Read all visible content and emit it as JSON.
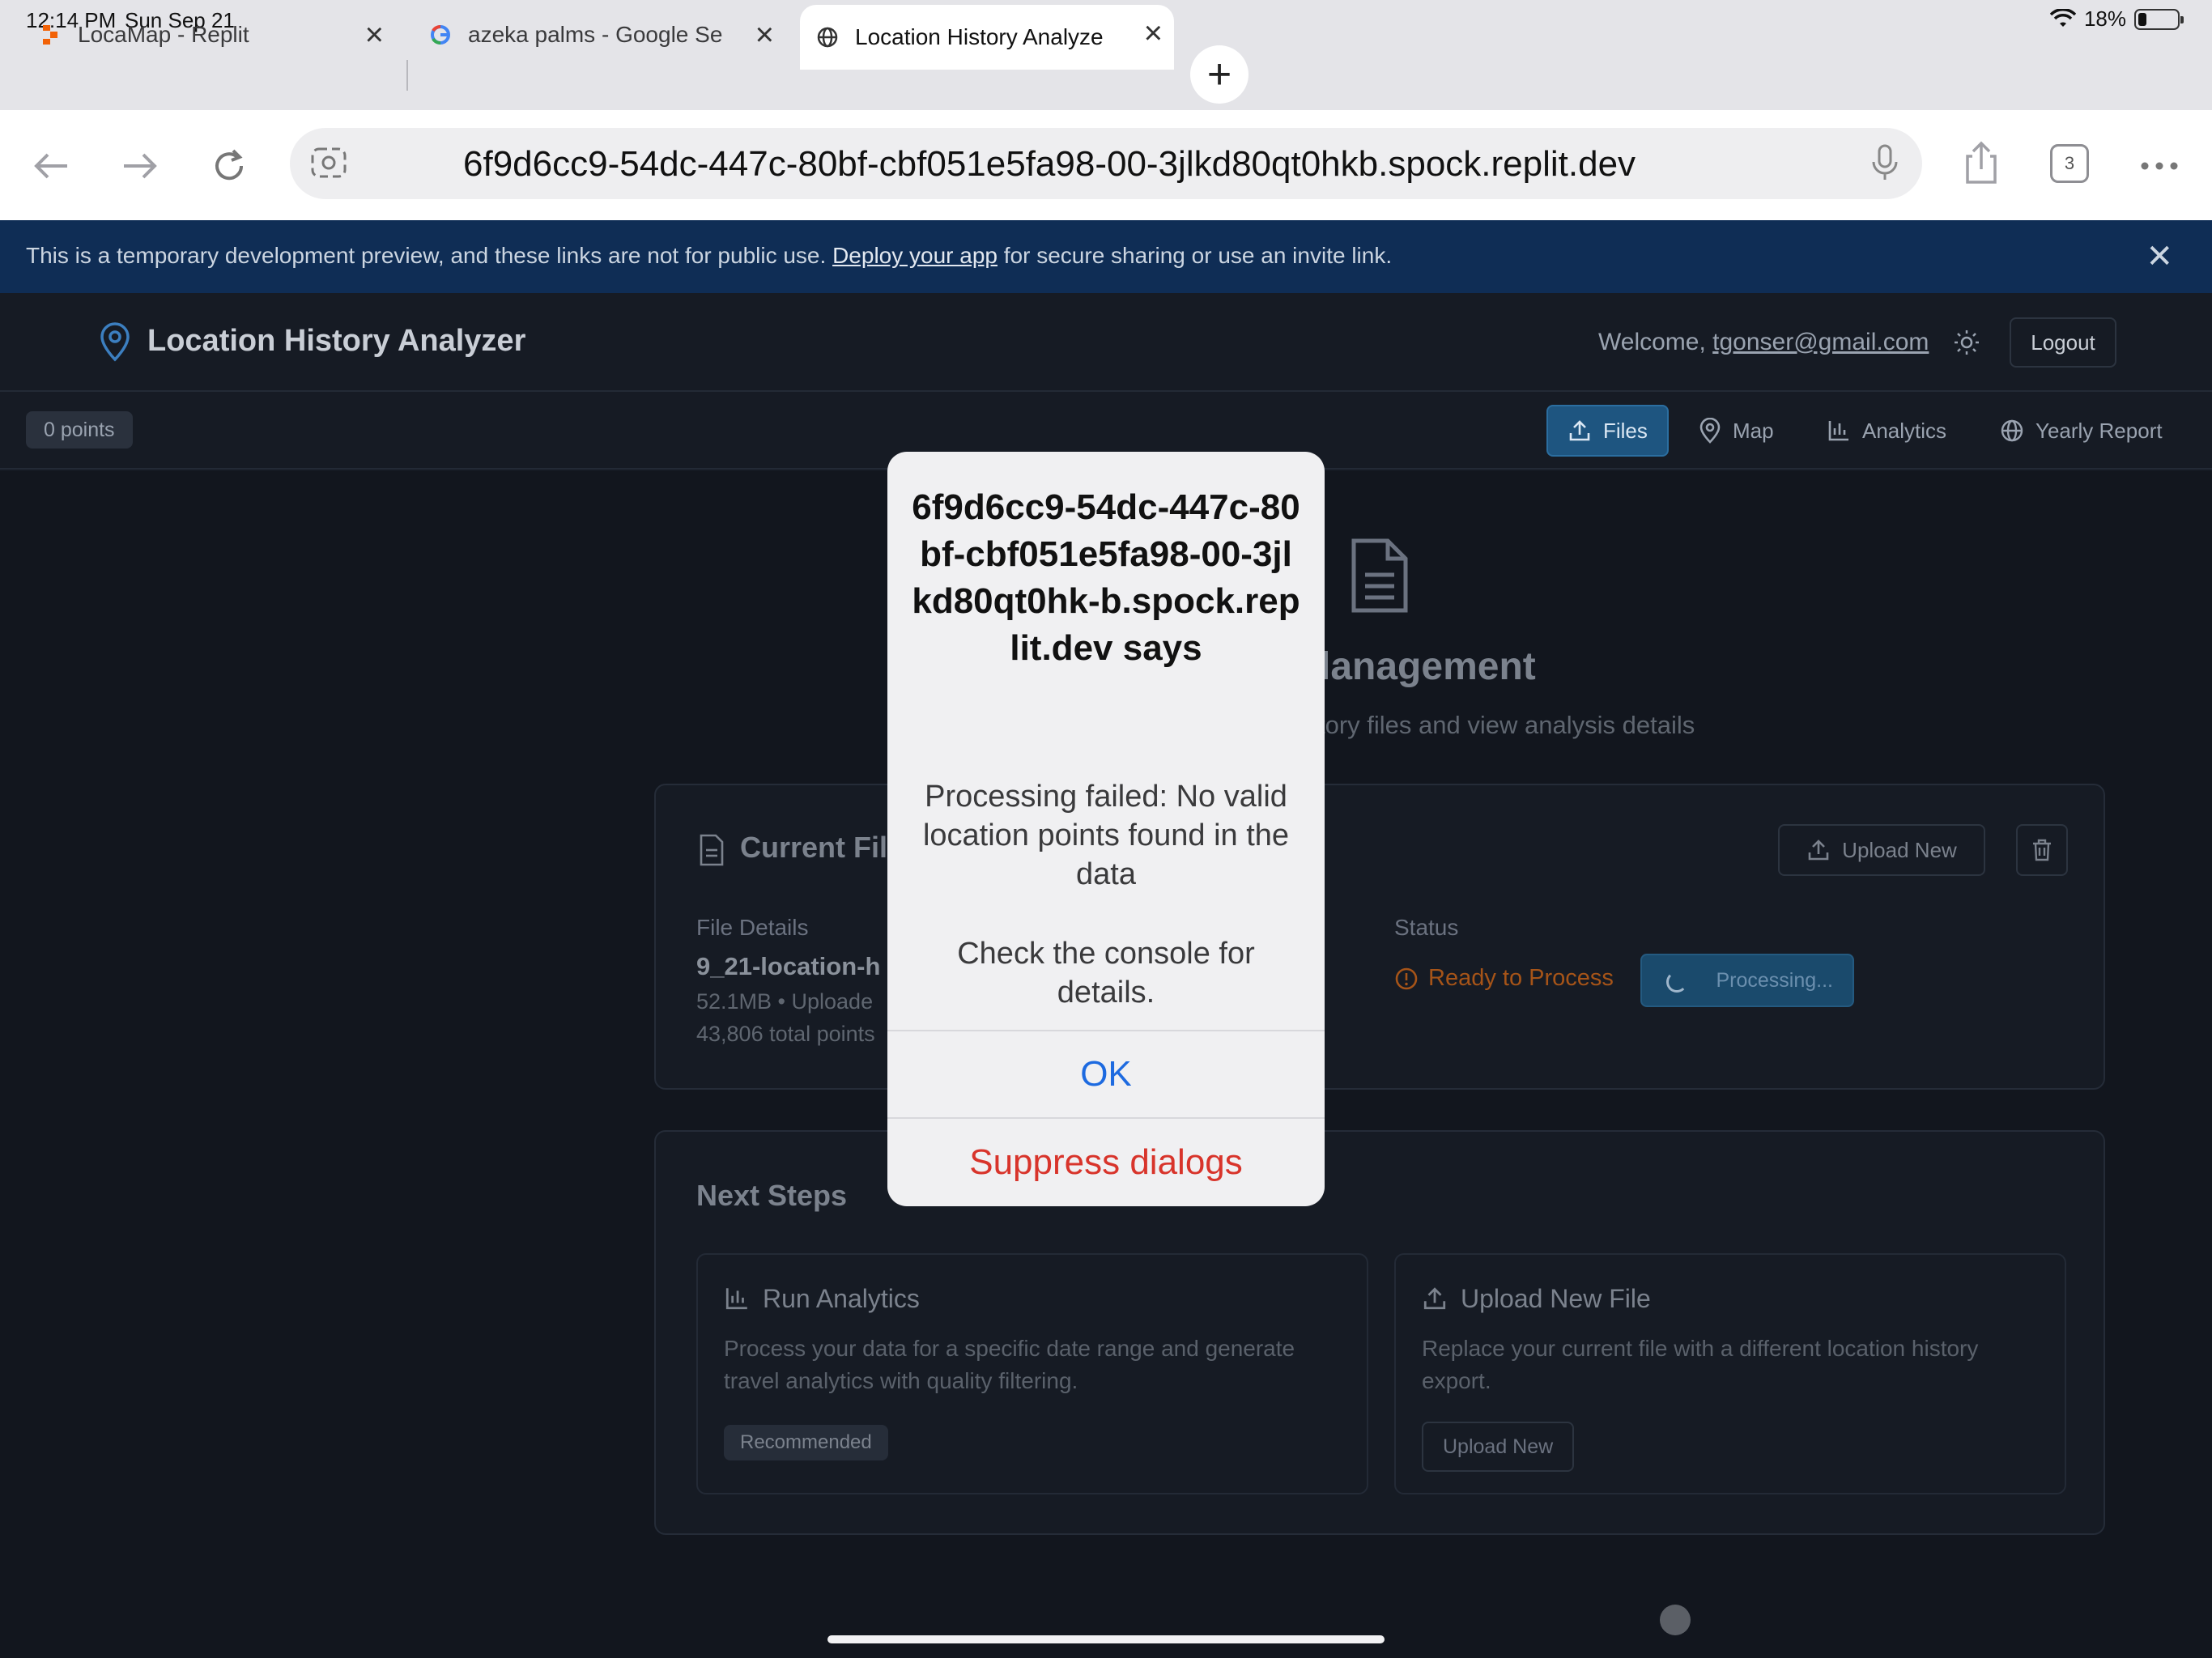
{
  "status_bar": {
    "time": "12:14 PM",
    "date": "Sun Sep 21",
    "battery": "18%"
  },
  "tabs": [
    {
      "label": "LocaMap - Replit",
      "icon": "replit-icon"
    },
    {
      "label": "azeka palms - Google Se",
      "icon": "google-icon"
    },
    {
      "label": "Location History Analyze",
      "icon": "globe-icon",
      "active": true
    }
  ],
  "address_bar": {
    "url": "6f9d6cc9-54dc-447c-80bf-cbf051e5fa98-00-3jlkd80qt0hkb.spock.replit.dev",
    "tab_count": "3"
  },
  "banner": {
    "text_before": "This is a temporary development preview, and these links are not for public use. ",
    "link": "Deploy your app",
    "text_after": " for secure sharing or use an invite link."
  },
  "app": {
    "title": "Location History Analyzer",
    "welcome_prefix": "Welcome, ",
    "user_email": "tgonser@gmail.com",
    "logout": "Logout",
    "points_badge": "0 points",
    "nav": [
      {
        "label": "Files",
        "icon": "upload-icon",
        "active": true
      },
      {
        "label": "Map",
        "icon": "map-pin-icon"
      },
      {
        "label": "Analytics",
        "icon": "bar-chart-icon"
      },
      {
        "label": "Yearly Report",
        "icon": "globe-icon"
      }
    ]
  },
  "hero": {
    "title_fragment": "lanagement",
    "subtitle_fragment": "tory files and view analysis details"
  },
  "current_file": {
    "title": "Current File",
    "upload_new": "Upload New",
    "file_details_label": "File Details",
    "file_name": "9_21-location-h",
    "meta": "52.1MB • Uploade",
    "total_points": "43,806 total points",
    "status_label": "Status",
    "status": "Ready to Process",
    "processing_button": "Processing..."
  },
  "next_steps": {
    "title": "Next Steps",
    "run_analytics": {
      "title": "Run Analytics",
      "desc": "Process your data for a specific date range and generate travel analytics with quality filtering.",
      "badge": "Recommended"
    },
    "upload_new_file": {
      "title": "Upload New File",
      "desc": "Replace your current file with a different location history export.",
      "button": "Upload New"
    }
  },
  "dialog": {
    "title": "6f9d6cc9-54dc-447c-80bf-cbf051e5fa98-00-3jlkd80qt0hk-b.spock.replit.dev says",
    "message": "Processing failed: No valid location points found in the data",
    "message2": "Check the console for details.",
    "ok": "OK",
    "suppress": "Suppress dialogs"
  }
}
